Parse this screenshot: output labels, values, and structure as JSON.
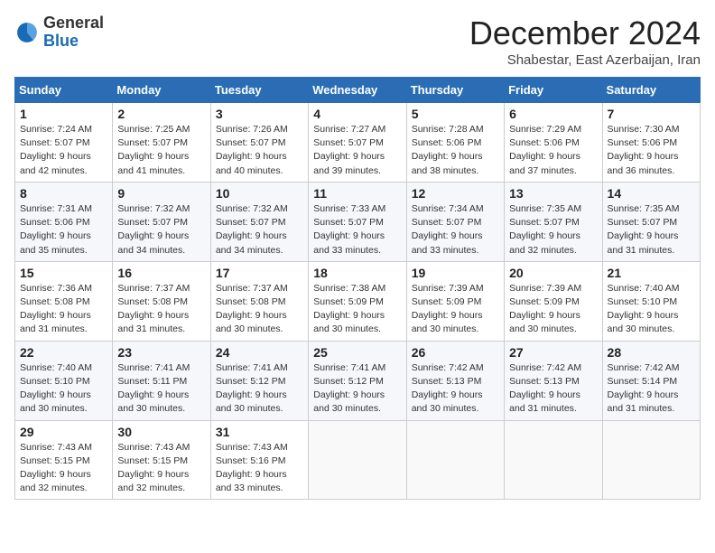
{
  "logo": {
    "general": "General",
    "blue": "Blue"
  },
  "header": {
    "month_title": "December 2024",
    "subtitle": "Shabestar, East Azerbaijan, Iran"
  },
  "weekdays": [
    "Sunday",
    "Monday",
    "Tuesday",
    "Wednesday",
    "Thursday",
    "Friday",
    "Saturday"
  ],
  "weeks": [
    [
      {
        "day": "1",
        "sunrise": "7:24 AM",
        "sunset": "5:07 PM",
        "daylight": "9 hours and 42 minutes."
      },
      {
        "day": "2",
        "sunrise": "7:25 AM",
        "sunset": "5:07 PM",
        "daylight": "9 hours and 41 minutes."
      },
      {
        "day": "3",
        "sunrise": "7:26 AM",
        "sunset": "5:07 PM",
        "daylight": "9 hours and 40 minutes."
      },
      {
        "day": "4",
        "sunrise": "7:27 AM",
        "sunset": "5:07 PM",
        "daylight": "9 hours and 39 minutes."
      },
      {
        "day": "5",
        "sunrise": "7:28 AM",
        "sunset": "5:06 PM",
        "daylight": "9 hours and 38 minutes."
      },
      {
        "day": "6",
        "sunrise": "7:29 AM",
        "sunset": "5:06 PM",
        "daylight": "9 hours and 37 minutes."
      },
      {
        "day": "7",
        "sunrise": "7:30 AM",
        "sunset": "5:06 PM",
        "daylight": "9 hours and 36 minutes."
      }
    ],
    [
      {
        "day": "8",
        "sunrise": "7:31 AM",
        "sunset": "5:06 PM",
        "daylight": "9 hours and 35 minutes."
      },
      {
        "day": "9",
        "sunrise": "7:32 AM",
        "sunset": "5:07 PM",
        "daylight": "9 hours and 34 minutes."
      },
      {
        "day": "10",
        "sunrise": "7:32 AM",
        "sunset": "5:07 PM",
        "daylight": "9 hours and 34 minutes."
      },
      {
        "day": "11",
        "sunrise": "7:33 AM",
        "sunset": "5:07 PM",
        "daylight": "9 hours and 33 minutes."
      },
      {
        "day": "12",
        "sunrise": "7:34 AM",
        "sunset": "5:07 PM",
        "daylight": "9 hours and 33 minutes."
      },
      {
        "day": "13",
        "sunrise": "7:35 AM",
        "sunset": "5:07 PM",
        "daylight": "9 hours and 32 minutes."
      },
      {
        "day": "14",
        "sunrise": "7:35 AM",
        "sunset": "5:07 PM",
        "daylight": "9 hours and 31 minutes."
      }
    ],
    [
      {
        "day": "15",
        "sunrise": "7:36 AM",
        "sunset": "5:08 PM",
        "daylight": "9 hours and 31 minutes."
      },
      {
        "day": "16",
        "sunrise": "7:37 AM",
        "sunset": "5:08 PM",
        "daylight": "9 hours and 31 minutes."
      },
      {
        "day": "17",
        "sunrise": "7:37 AM",
        "sunset": "5:08 PM",
        "daylight": "9 hours and 30 minutes."
      },
      {
        "day": "18",
        "sunrise": "7:38 AM",
        "sunset": "5:09 PM",
        "daylight": "9 hours and 30 minutes."
      },
      {
        "day": "19",
        "sunrise": "7:39 AM",
        "sunset": "5:09 PM",
        "daylight": "9 hours and 30 minutes."
      },
      {
        "day": "20",
        "sunrise": "7:39 AM",
        "sunset": "5:09 PM",
        "daylight": "9 hours and 30 minutes."
      },
      {
        "day": "21",
        "sunrise": "7:40 AM",
        "sunset": "5:10 PM",
        "daylight": "9 hours and 30 minutes."
      }
    ],
    [
      {
        "day": "22",
        "sunrise": "7:40 AM",
        "sunset": "5:10 PM",
        "daylight": "9 hours and 30 minutes."
      },
      {
        "day": "23",
        "sunrise": "7:41 AM",
        "sunset": "5:11 PM",
        "daylight": "9 hours and 30 minutes."
      },
      {
        "day": "24",
        "sunrise": "7:41 AM",
        "sunset": "5:12 PM",
        "daylight": "9 hours and 30 minutes."
      },
      {
        "day": "25",
        "sunrise": "7:41 AM",
        "sunset": "5:12 PM",
        "daylight": "9 hours and 30 minutes."
      },
      {
        "day": "26",
        "sunrise": "7:42 AM",
        "sunset": "5:13 PM",
        "daylight": "9 hours and 30 minutes."
      },
      {
        "day": "27",
        "sunrise": "7:42 AM",
        "sunset": "5:13 PM",
        "daylight": "9 hours and 31 minutes."
      },
      {
        "day": "28",
        "sunrise": "7:42 AM",
        "sunset": "5:14 PM",
        "daylight": "9 hours and 31 minutes."
      }
    ],
    [
      {
        "day": "29",
        "sunrise": "7:43 AM",
        "sunset": "5:15 PM",
        "daylight": "9 hours and 32 minutes."
      },
      {
        "day": "30",
        "sunrise": "7:43 AM",
        "sunset": "5:15 PM",
        "daylight": "9 hours and 32 minutes."
      },
      {
        "day": "31",
        "sunrise": "7:43 AM",
        "sunset": "5:16 PM",
        "daylight": "9 hours and 33 minutes."
      },
      null,
      null,
      null,
      null
    ]
  ]
}
